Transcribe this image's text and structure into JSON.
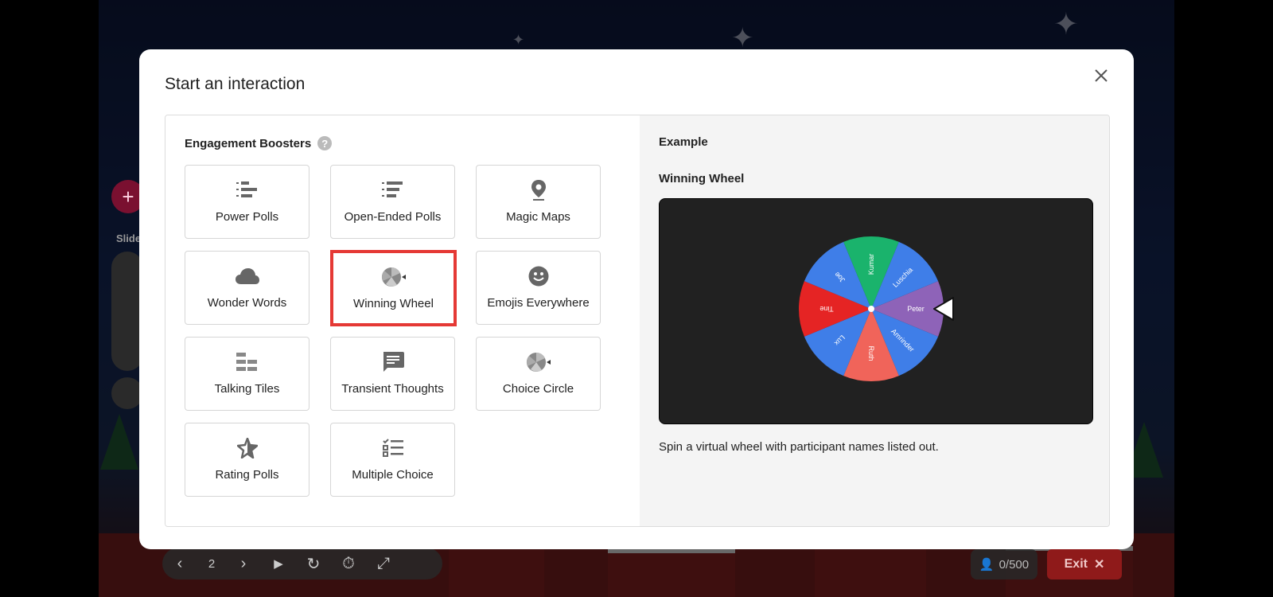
{
  "modal": {
    "title": "Start an interaction",
    "close_icon": "close-icon"
  },
  "engagement": {
    "heading": "Engagement Boosters",
    "help_symbol": "?",
    "items": [
      {
        "label": "Power Polls",
        "icon": "numbered-bars-icon"
      },
      {
        "label": "Open-Ended Polls",
        "icon": "numbered-lines-icon"
      },
      {
        "label": "Magic Maps",
        "icon": "map-pin-icon"
      },
      {
        "label": "Wonder Words",
        "icon": "cloud-icon"
      },
      {
        "label": "Winning Wheel",
        "icon": "wheel-icon",
        "selected": true
      },
      {
        "label": "Emojis Everywhere",
        "icon": "smiley-icon"
      },
      {
        "label": "Talking Tiles",
        "icon": "tiles-icon"
      },
      {
        "label": "Transient Thoughts",
        "icon": "chat-bubble-icon"
      },
      {
        "label": "Choice Circle",
        "icon": "wheel-icon"
      },
      {
        "label": "Rating Polls",
        "icon": "star-icon"
      },
      {
        "label": "Multiple Choice",
        "icon": "checklist-icon"
      }
    ]
  },
  "example": {
    "heading": "Example",
    "name": "Winning Wheel",
    "description": "Spin a virtual wheel with participant names listed out.",
    "wheel": {
      "names": [
        "Peter",
        "Amrinder",
        "Ruth",
        "Lux",
        "Tine",
        "Joe",
        "Kumar",
        "Luschia"
      ],
      "colors": [
        "#8e63b8",
        "#3f7ee8",
        "#f0645a",
        "#3f7ee8",
        "#e52424",
        "#3f7ee8",
        "#1ab36c",
        "#3f7ee8"
      ]
    }
  },
  "background": {
    "sidebar_label": "Slide",
    "add_symbol": "+",
    "toolbar": {
      "page": "2"
    },
    "participants": "0/500",
    "exit_label": "Exit"
  }
}
